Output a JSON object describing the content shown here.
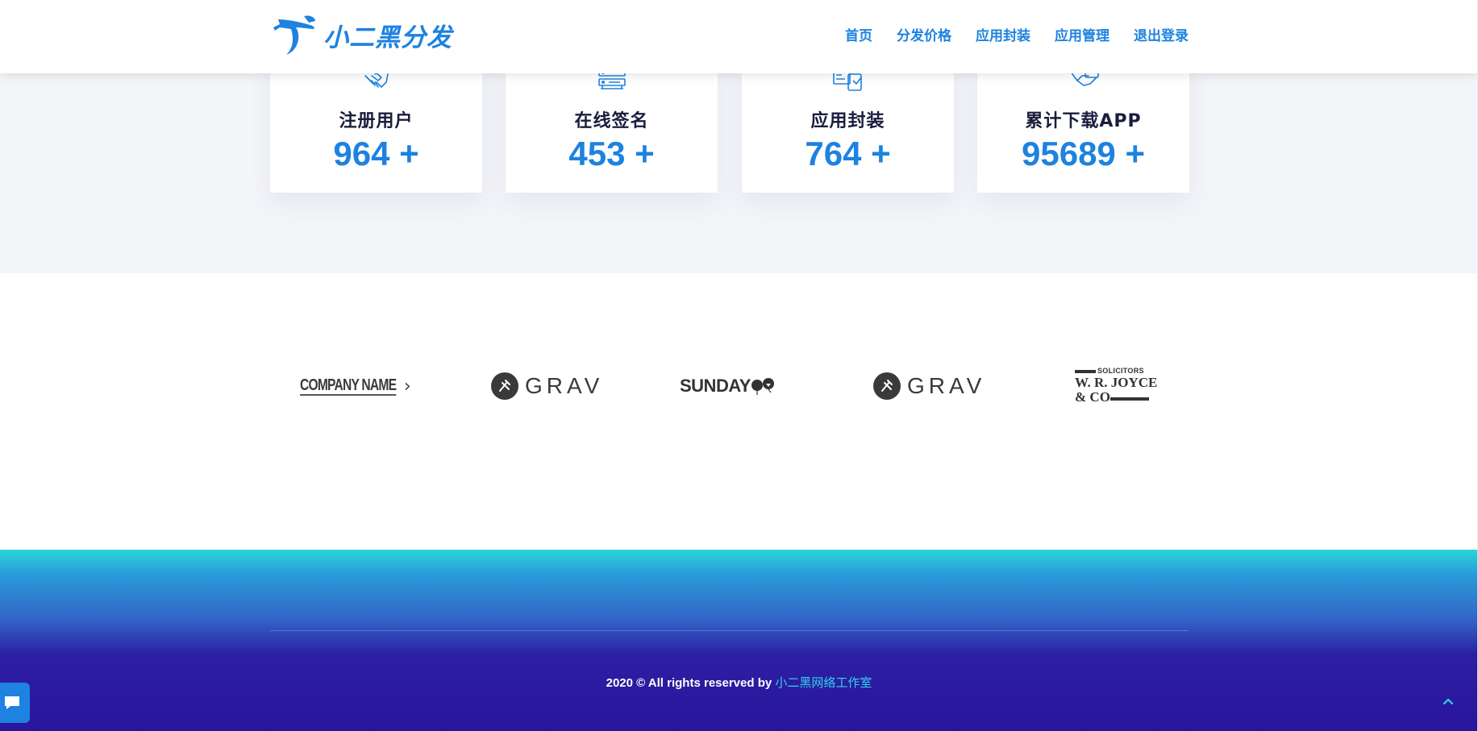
{
  "header": {
    "logo_text": "小二黑分发",
    "nav": [
      {
        "label": "首页"
      },
      {
        "label": "分发价格"
      },
      {
        "label": "应用封装"
      },
      {
        "label": "应用管理"
      },
      {
        "label": "退出登录"
      }
    ]
  },
  "stats": [
    {
      "label": "注册用户",
      "value": "964 +",
      "icon": "handshake-icon"
    },
    {
      "label": "在线签名",
      "value": "453 +",
      "icon": "server-icon"
    },
    {
      "label": "应用封装",
      "value": "764 +",
      "icon": "package-icon"
    },
    {
      "label": "累计下载APP",
      "value": "95689 +",
      "icon": "hand-phone-icon"
    }
  ],
  "partners": {
    "company_name": "COMPANY NAME",
    "grav_1": "GRAV",
    "sunday": "SUNDAY",
    "grav_2": "GRAV",
    "joyce_small": "SOLICITORS",
    "joyce_main": "W. R. JOYCE",
    "joyce_co": "& CO"
  },
  "footer": {
    "copyright_text": "2020 © All rights reserved by ",
    "studio_name": "小二黑网络工作室"
  },
  "colors": {
    "brand_blue": "#1d82e0",
    "heading_dark": "#1a1d3c",
    "link_cyan": "#2fd3e8",
    "footer_top": "#2bd4d8",
    "footer_bottom": "#29159c"
  },
  "icons": {
    "chat": "chat-bubble-icon",
    "back_to_top": "chevron-up-icon",
    "logo": "plane-logo-icon"
  }
}
